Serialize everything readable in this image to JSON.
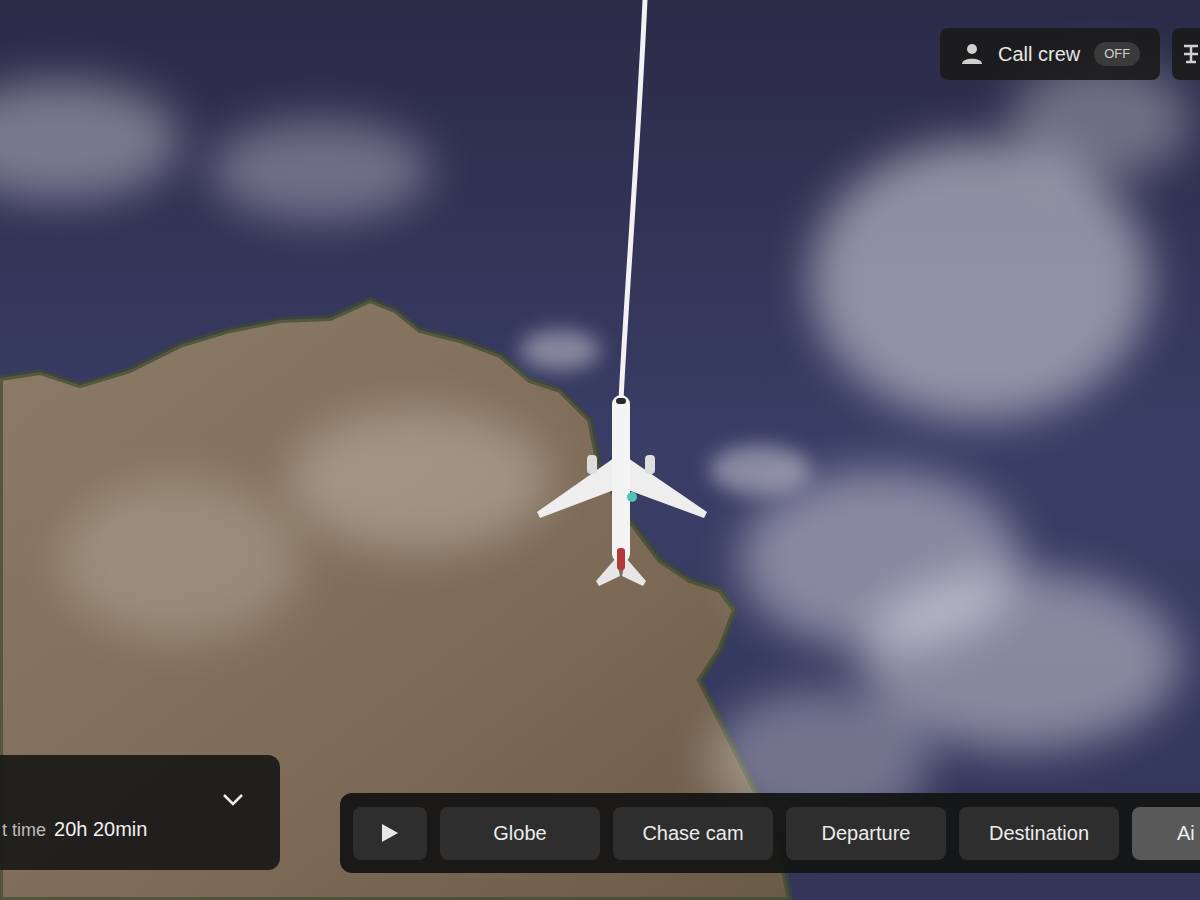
{
  "call_crew": {
    "label": "Call crew",
    "state": "OFF",
    "on": false
  },
  "flight_info": {
    "label": "t time",
    "value": "20h 20min",
    "expanded": false
  },
  "view_buttons": [
    {
      "label": "Globe",
      "selected": false
    },
    {
      "label": "Chase cam",
      "selected": false
    },
    {
      "label": "Departure",
      "selected": false
    },
    {
      "label": "Destination",
      "selected": false
    },
    {
      "label": "Ai",
      "selected": true
    }
  ]
}
